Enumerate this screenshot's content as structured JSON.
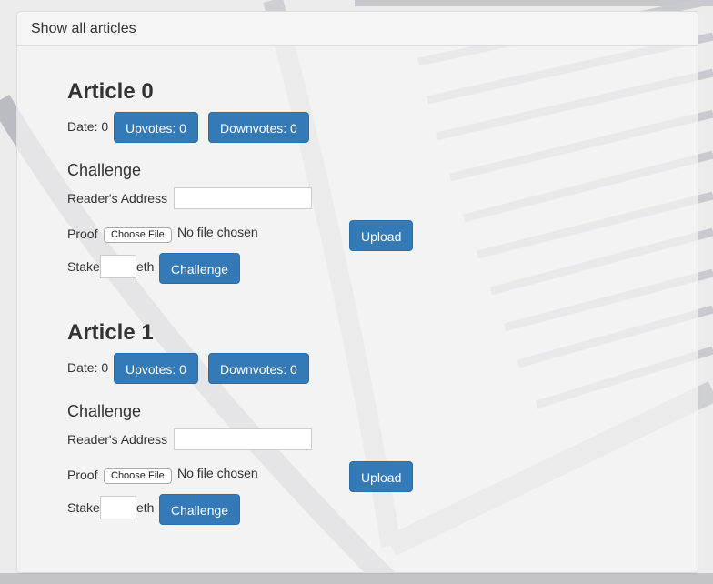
{
  "panel": {
    "heading": "Show all articles"
  },
  "articles": [
    {
      "title": "Article 0",
      "date_label": "Date: 0",
      "upvotes_label": "Upvotes: 0",
      "downvotes_label": "Downvotes: 0",
      "challenge": {
        "heading": "Challenge",
        "reader_label": "Reader's Address",
        "reader_value": "",
        "proof_label": "Proof",
        "choose_file_label": "Choose File",
        "file_status": "No file chosen",
        "upload_label": "Upload",
        "stake_label": "Stake",
        "stake_value": "",
        "stake_unit": "eth",
        "challenge_button_label": "Challenge"
      }
    },
    {
      "title": "Article 1",
      "date_label": "Date: 0",
      "upvotes_label": "Upvotes: 0",
      "downvotes_label": "Downvotes: 0",
      "challenge": {
        "heading": "Challenge",
        "reader_label": "Reader's Address",
        "reader_value": "",
        "proof_label": "Proof",
        "choose_file_label": "Choose File",
        "file_status": "No file chosen",
        "upload_label": "Upload",
        "stake_label": "Stake",
        "stake_value": "",
        "stake_unit": "eth",
        "challenge_button_label": "Challenge"
      }
    }
  ],
  "colors": {
    "primary_button": "#337ab7",
    "primary_button_border": "#2e6da4",
    "panel_border": "#dddddd",
    "text": "#333333"
  },
  "icons": {
    "background": "newspaper-background-art"
  }
}
